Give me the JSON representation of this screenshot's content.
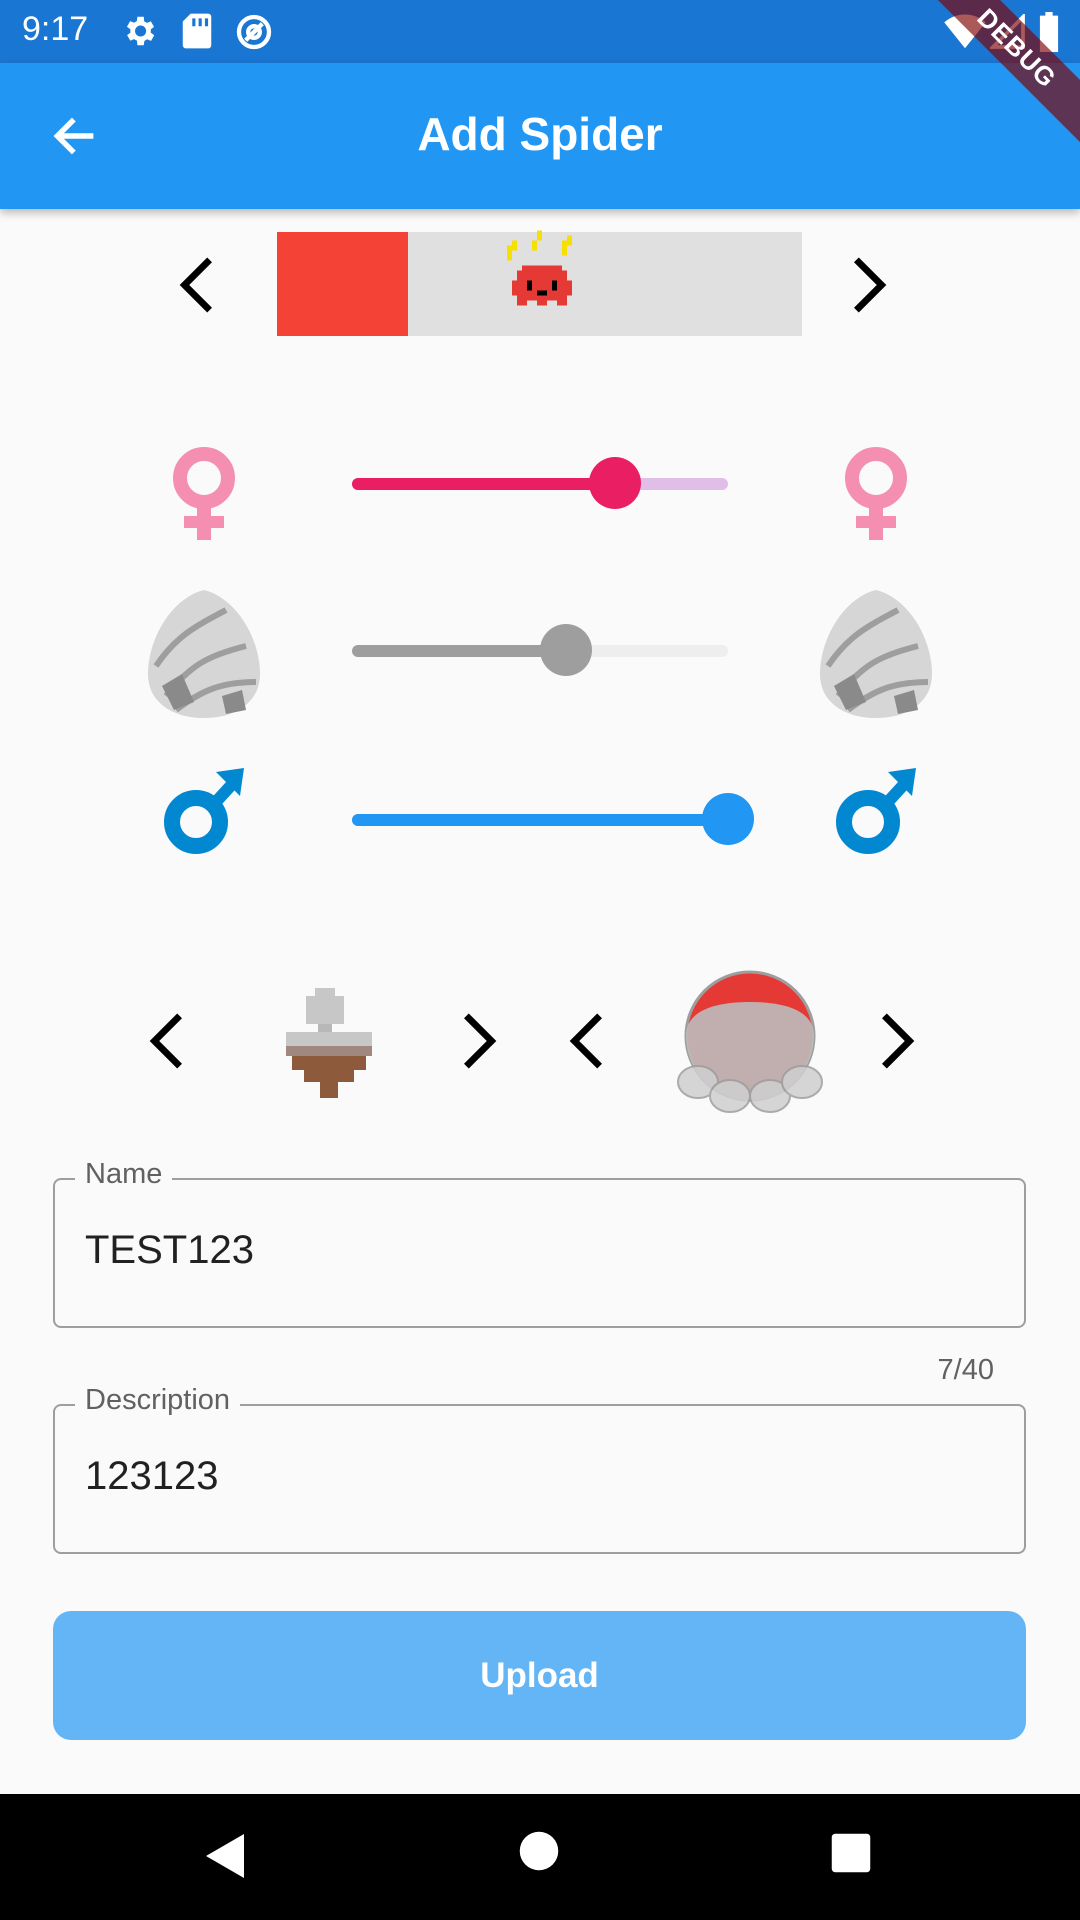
{
  "status_bar": {
    "time": "9:17",
    "left_icons": [
      "gear-icon",
      "sd-card-icon",
      "at-sign-icon"
    ],
    "right_icons": [
      "wifi-icon",
      "signal-icon",
      "battery-icon"
    ]
  },
  "debug_banner": "DEBUG",
  "app_bar": {
    "title": "Add Spider",
    "back_icon": "arrow-back-icon"
  },
  "color_selector": {
    "selected_color": "#f44336",
    "preview_bg": "#e0e0e0",
    "sprite_color": "#e53935"
  },
  "sliders": [
    {
      "name": "female",
      "value": 0.7,
      "active_color": "#e91e63",
      "inactive_color": "#e1bee7",
      "icon": "female-icon",
      "icon_color": "#f48fb1"
    },
    {
      "name": "egg",
      "value": 0.57,
      "active_color": "#9e9e9e",
      "inactive_color": "#eeeeee",
      "icon": "egg-icon",
      "icon_color": "#bdbdbd"
    },
    {
      "name": "male",
      "value": 1.0,
      "active_color": "#2196f3",
      "inactive_color": "#bbdefb",
      "icon": "male-icon",
      "icon_color": "#0288d1"
    }
  ],
  "pickers": {
    "left": {
      "icon": "spider-body-pixel-icon"
    },
    "right": {
      "icon": "spider-leg-shell-icon"
    }
  },
  "form": {
    "name_label": "Name",
    "name_value": "TEST123",
    "name_counter": "7/40",
    "description_label": "Description",
    "description_value": "123123"
  },
  "upload_label": "Upload",
  "nav": [
    "back-triangle-icon",
    "home-circle-icon",
    "recents-square-icon"
  ]
}
